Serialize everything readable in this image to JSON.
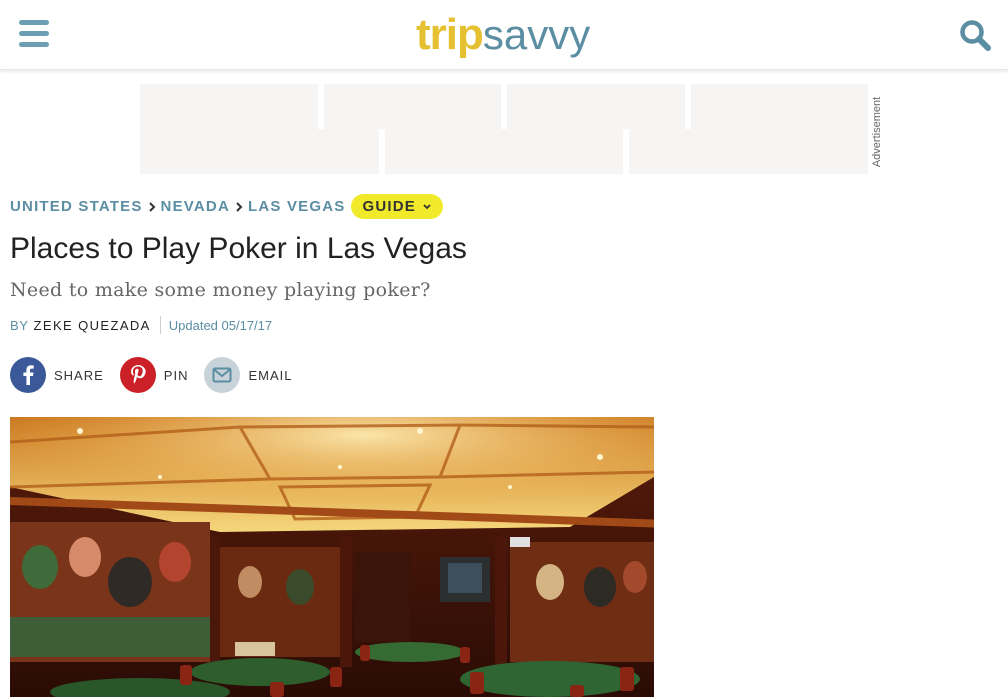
{
  "header": {
    "logo_trip": "trip",
    "logo_savvy": "savvy",
    "menu_icon": "hamburger-menu-icon",
    "search_icon": "search-icon"
  },
  "ad": {
    "label": "Advertisement"
  },
  "breadcrumb": {
    "items": [
      "UNITED STATES",
      "NEVADA",
      "LAS VEGAS"
    ],
    "guide_label": "GUIDE"
  },
  "article": {
    "title": "Places to Play Poker in Las Vegas",
    "subtitle": "Need to make some money playing poker?",
    "by": "BY",
    "author": "ZEKE QUEZADA",
    "updated": "Updated 05/17/17"
  },
  "social": {
    "share_label": "SHARE",
    "pin_label": "PIN",
    "email_label": "EMAIL"
  },
  "colors": {
    "brand_yellow": "#e5c132",
    "brand_blue": "#5b8da3",
    "facebook": "#3b5998",
    "pinterest": "#cb2027",
    "email": "#c7d3d9",
    "guide_pill": "#f1ea2a"
  }
}
